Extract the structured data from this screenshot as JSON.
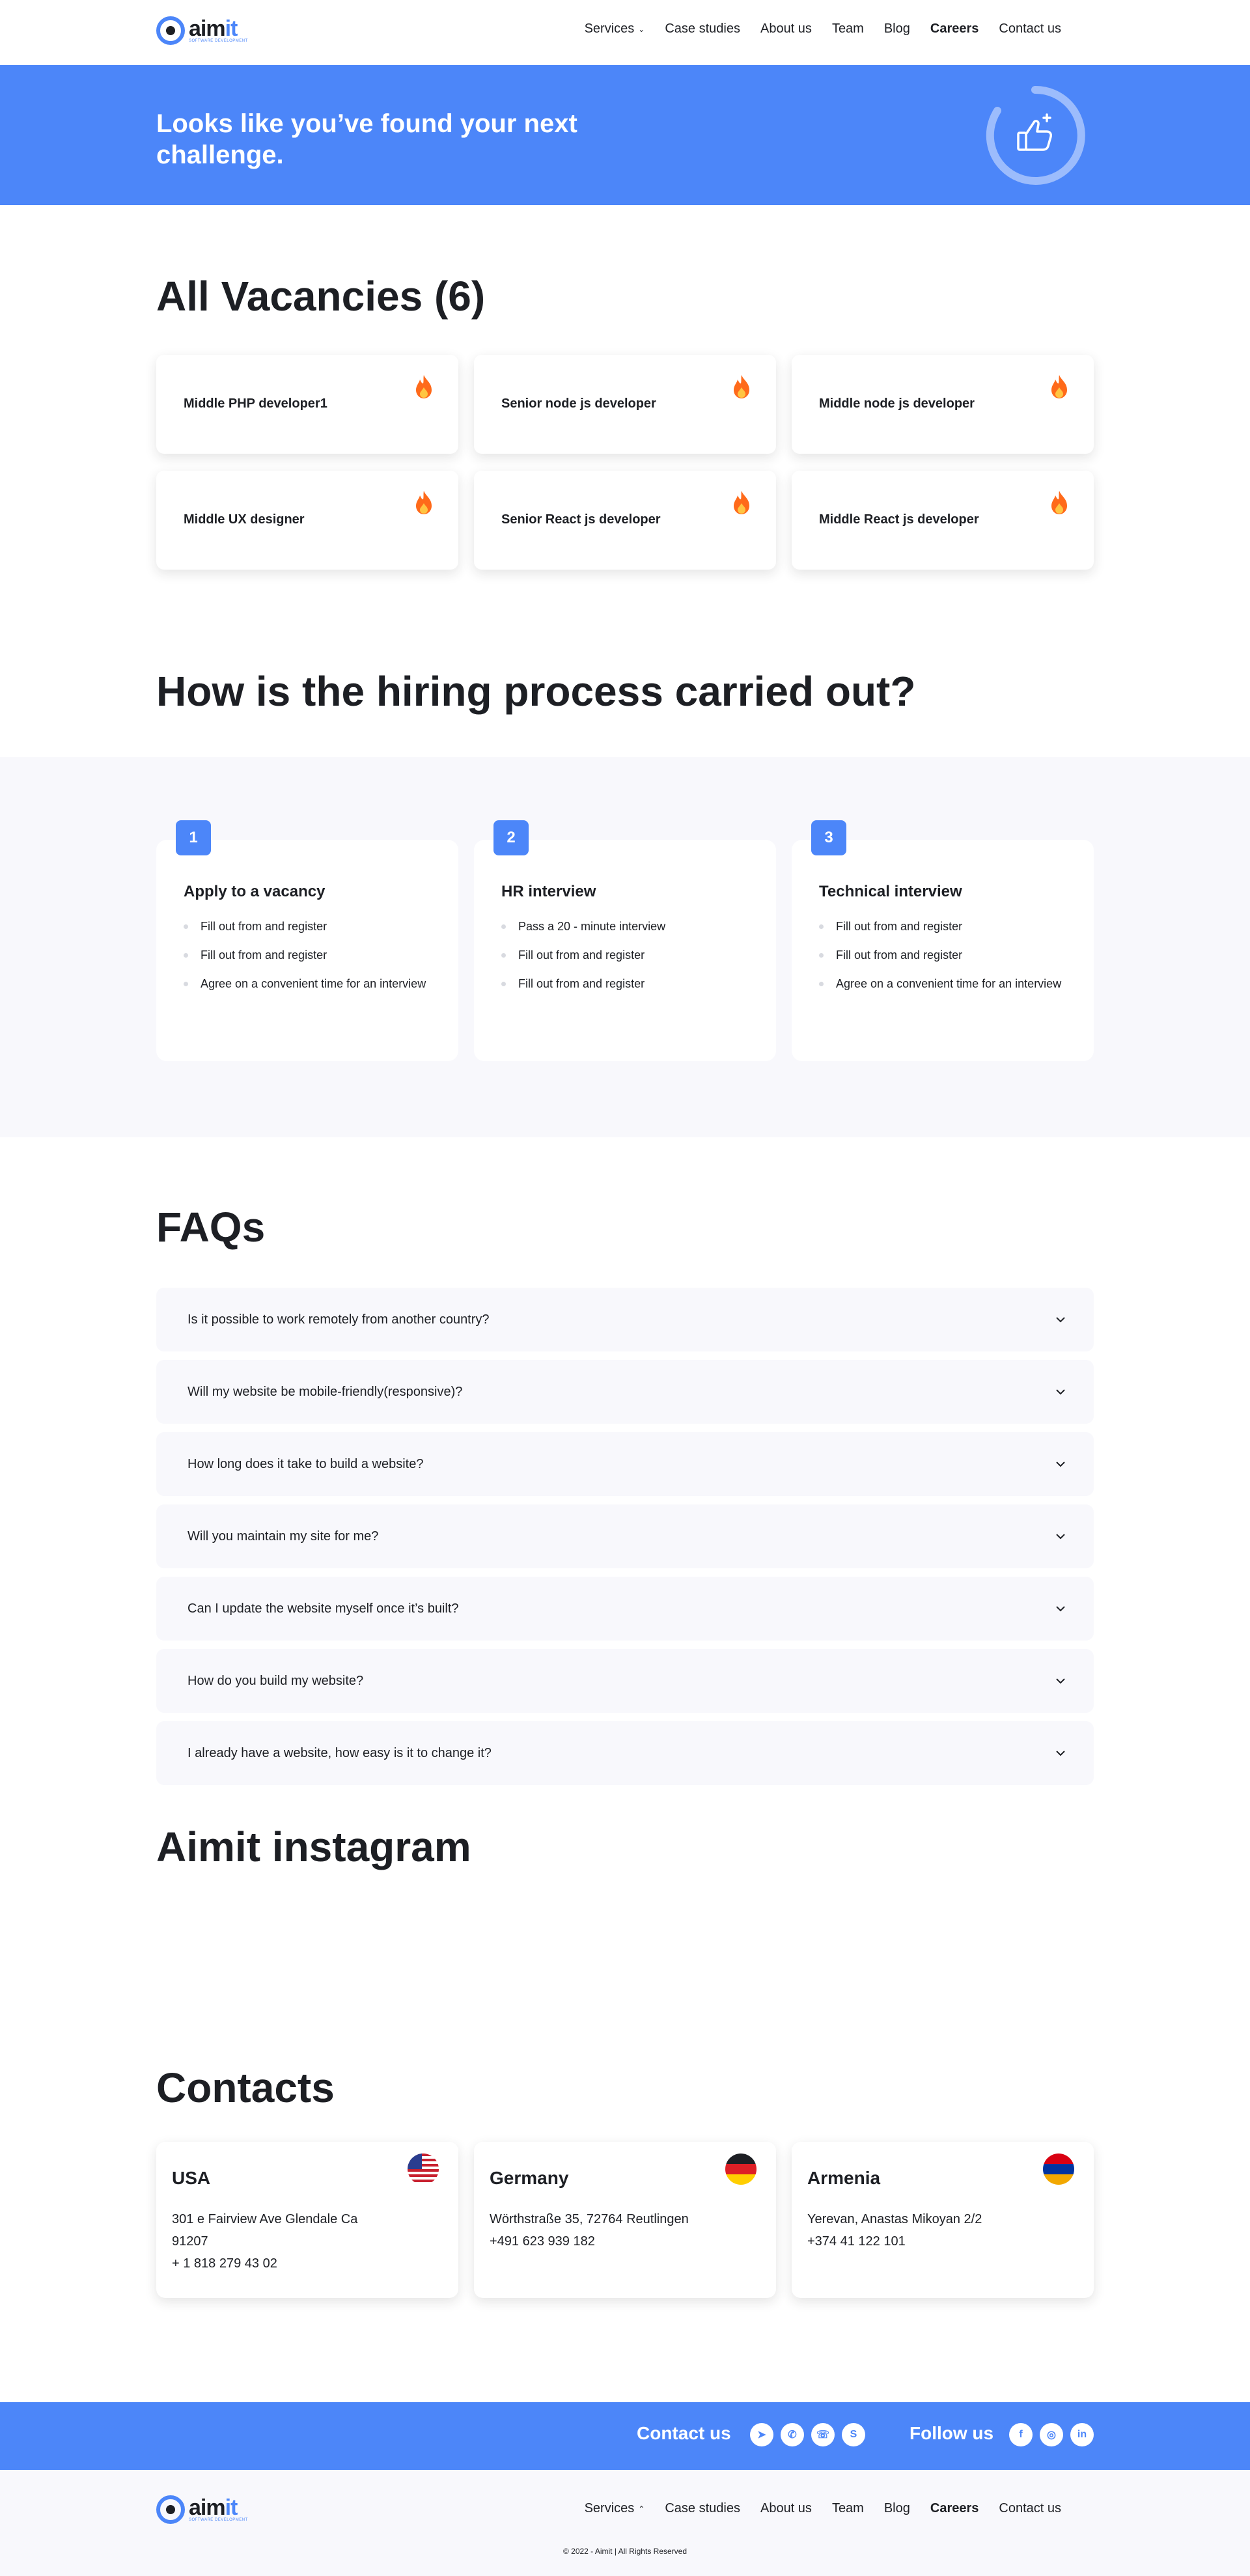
{
  "brand": {
    "word_main": "aim",
    "word_accent": "it",
    "tagline": "SOFTWARE DEVELOPMENT"
  },
  "nav": [
    {
      "label": "Services",
      "active": false,
      "chevron": "chevron-down-icon"
    },
    {
      "label": "Case studies",
      "active": false
    },
    {
      "label": "About us",
      "active": false
    },
    {
      "label": "Team",
      "active": false
    },
    {
      "label": "Blog",
      "active": false
    },
    {
      "label": "Careers",
      "active": true
    },
    {
      "label": "Contact us",
      "active": false
    }
  ],
  "hero": {
    "title": "Looks like you’ve found your next challenge.",
    "badge_icon": "thumbs-up-icon"
  },
  "vacancies": {
    "title": "All Vacancies (6)",
    "items": [
      {
        "title": "Middle PHP developer1",
        "icon": "fire-icon"
      },
      {
        "title": "Senior node js developer",
        "icon": "fire-icon"
      },
      {
        "title": "Middle node js developer",
        "icon": "fire-icon"
      },
      {
        "title": "Middle UX designer",
        "icon": "fire-icon"
      },
      {
        "title": "Senior React js developer",
        "icon": "fire-icon"
      },
      {
        "title": "Middle React js developer",
        "icon": "fire-icon"
      }
    ]
  },
  "process": {
    "title": "How is the hiring process carried out?",
    "steps": [
      {
        "number": "1",
        "title": "Apply to a vacancy",
        "items": [
          "Fill out from and register",
          "Fill out from and register",
          "Agree on a convenient time for an interview"
        ]
      },
      {
        "number": "2",
        "title": "HR interview",
        "items": [
          "Pass a 20 - minute interview",
          "Fill out from and register",
          "Fill out from and register"
        ]
      },
      {
        "number": "3",
        "title": "Technical interview",
        "items": [
          "Fill out from and register",
          "Fill out from and register",
          "Agree on a convenient time for an interview"
        ]
      }
    ]
  },
  "faq": {
    "title": "FAQs",
    "items": [
      "Is it possible to work remotely from another country?",
      "Will my website be mobile-friendly(responsive)?",
      "How long does it take to build a website?",
      "Will you maintain my site for me?",
      "Can I update the website myself once it’s built?",
      "How do you build my website?",
      "I already have a website, how easy is it to change it?"
    ]
  },
  "instagram": {
    "title": "Aimit instagram"
  },
  "contacts": {
    "title": "Contacts",
    "items": [
      {
        "country": "USA",
        "flag": "usa-flag-icon",
        "lines": [
          "301 e Fairview Ave Glendale Ca",
          "91207",
          "+ 1 818 279 43 02"
        ]
      },
      {
        "country": "Germany",
        "flag": "germany-flag-icon",
        "lines": [
          "Wörthstraße 35, 72764 Reutlingen",
          "+491 623 939 182"
        ]
      },
      {
        "country": "Armenia",
        "flag": "armenia-flag-icon",
        "lines": [
          "Yerevan, Anastas Mikoyan 2/2",
          "+374 41 122 101"
        ]
      }
    ]
  },
  "footer_bar": {
    "contact_label": "Contact us",
    "contact_icons": [
      "telegram-icon",
      "whatsapp-icon",
      "viber-icon",
      "skype-icon"
    ],
    "follow_label": "Follow us",
    "follow_icons": [
      "facebook-icon",
      "instagram-icon",
      "linkedin-icon"
    ]
  },
  "footer": {
    "nav_services_chevron": "chevron-up-icon",
    "copyright": "© 2022 - Aimit | All Rights Reserved"
  },
  "colors": {
    "accent": "#4c86f9",
    "text": "#1d1f24",
    "soft_bg": "#f8f8fc",
    "fire": "#ff6a1a"
  }
}
